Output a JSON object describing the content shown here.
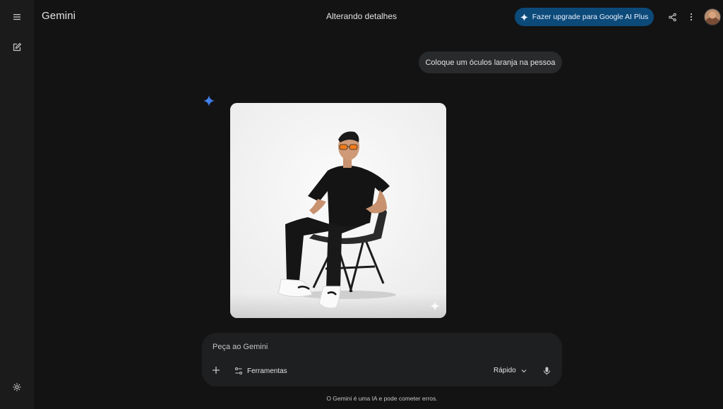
{
  "header": {
    "brand": "Gemini",
    "chat_title": "Alterando detalhes",
    "upgrade_label": "Fazer upgrade para Google AI Plus"
  },
  "conversation": {
    "user_message": "Coloque um óculos laranja na pessoa",
    "response_image": {
      "subject": "man in black t-shirt and black pants with orange sunglasses seated on a black chair, white sneakers, white studio background"
    }
  },
  "composer": {
    "placeholder": "Peça ao Gemini",
    "tools_label": "Ferramentas",
    "mode_label": "Rápido"
  },
  "footer": {
    "disclaimer": "O Gemini é uma IA e pode cometer erros."
  },
  "colors": {
    "background": "#131314",
    "sidebar": "#1b1b1c",
    "accent_button": "#0c4a7a",
    "gemini_spark": "#4b8df8"
  },
  "icons": [
    "menu-icon",
    "new-chat-icon",
    "settings-icon",
    "sparkle-icon",
    "share-icon",
    "more-vert-icon",
    "plus-icon",
    "tools-icon",
    "chevron-down-icon",
    "mic-icon"
  ]
}
